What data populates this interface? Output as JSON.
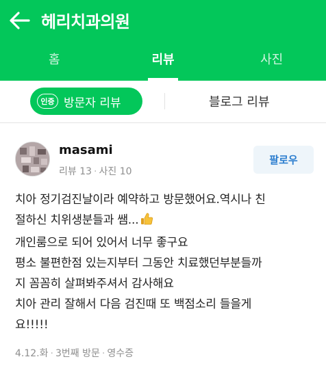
{
  "header": {
    "title": "헤리치과의원",
    "back_icon": "arrow-left-icon",
    "color": "#03c75a"
  },
  "tabs": [
    {
      "label": "홈",
      "active": false
    },
    {
      "label": "리뷰",
      "active": true
    },
    {
      "label": "사진",
      "active": false
    }
  ],
  "filter": {
    "badge": "인증",
    "visitor_review_label": "방문자 리뷰",
    "blog_review_label": "블로그 리뷰"
  },
  "review": {
    "username": "masami",
    "review_count": "리뷰 13",
    "photo_count": "사진 10",
    "follow_label": "팔로우",
    "lines": [
      "치아 정기검진날이라 예약하고 방문했어요.역시나 친",
      "절하신 치위생분들과 쌤...",
      "개인룸으로 되어 있어서 너무 좋구요",
      "평소 불편한점 있는지부터 그동안 치료했던부분들까",
      "지 꼼꼼히 살펴봐주셔서 감사해요",
      "치아 관리 잘해서 다음 검진때 또 백점소리 들을게",
      "요!!!!!"
    ],
    "emoji_icon": "thumbs-up-icon",
    "date": "4.12.화",
    "visit": "3번째 방문",
    "receipt": "영수증"
  }
}
